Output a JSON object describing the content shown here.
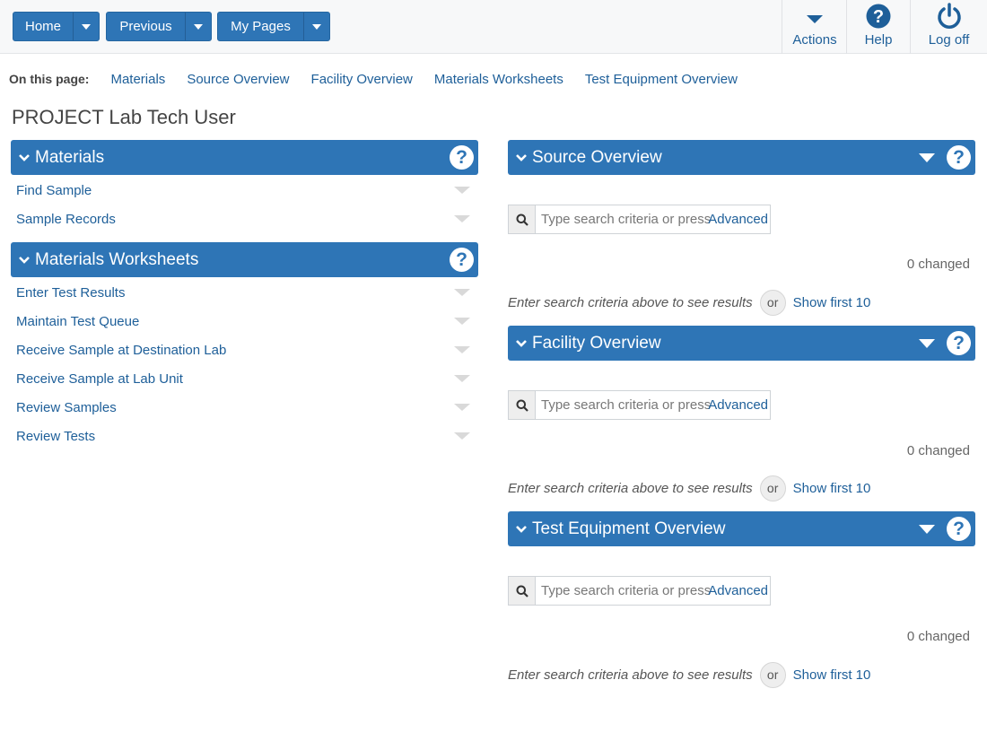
{
  "topbar": {
    "home_label": "Home",
    "previous_label": "Previous",
    "mypages_label": "My Pages",
    "actions_label": "Actions",
    "help_label": "Help",
    "logoff_label": "Log off"
  },
  "on_this_page": {
    "heading": "On this page:",
    "links": [
      "Materials",
      "Source Overview",
      "Facility Overview",
      "Materials Worksheets",
      "Test Equipment Overview"
    ]
  },
  "page_title": "PROJECT Lab Tech User",
  "left_panels": [
    {
      "title": "Materials",
      "help": "?",
      "items": [
        "Find Sample",
        "Sample Records"
      ]
    },
    {
      "title": "Materials Worksheets",
      "help": "?",
      "items": [
        "Enter Test Results",
        "Maintain Test Queue",
        "Receive Sample at Destination Lab",
        "Receive Sample at Lab Unit",
        "Review Samples",
        "Review Tests"
      ]
    }
  ],
  "right_panels": [
    {
      "title": "Source Overview",
      "help": "?",
      "search_placeholder": "Type search criteria or press Enter",
      "advanced_label": "Advanced",
      "changed_text": "0 changed",
      "hint": "Enter search criteria above to see results",
      "or": "or",
      "show_label": "Show first 10"
    },
    {
      "title": "Facility Overview",
      "help": "?",
      "search_placeholder": "Type search criteria or press Enter",
      "advanced_label": "Advanced",
      "changed_text": "0 changed",
      "hint": "Enter search criteria above to see results",
      "or": "or",
      "show_label": "Show first 10"
    },
    {
      "title": "Test Equipment Overview",
      "help": "?",
      "search_placeholder": "Type search criteria or press Enter",
      "advanced_label": "Advanced",
      "changed_text": "0 changed",
      "hint": "Enter search criteria above to see results",
      "or": "or",
      "show_label": "Show first 10"
    }
  ],
  "colors": {
    "primary": "#2e75b6",
    "link": "#1e5f99"
  }
}
